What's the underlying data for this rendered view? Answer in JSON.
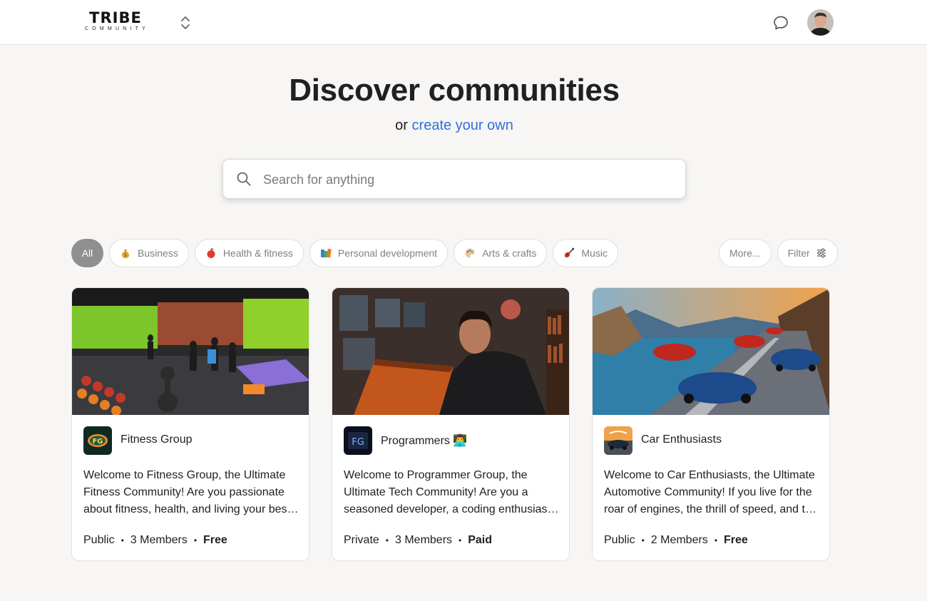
{
  "header": {
    "logo_main": "TRIBE",
    "logo_sub": "COMMUNITY"
  },
  "hero": {
    "title": "Discover communities",
    "subtitle_prefix": "or",
    "subtitle_link": "create your own"
  },
  "search": {
    "placeholder": "Search for anything",
    "value": ""
  },
  "categories": [
    {
      "label": "All",
      "active": true
    },
    {
      "label": "Business",
      "icon": "money-bag-icon"
    },
    {
      "label": "Health & fitness",
      "icon": "apple-icon"
    },
    {
      "label": "Personal development",
      "icon": "books-icon"
    },
    {
      "label": "Arts & crafts",
      "icon": "palette-icon"
    },
    {
      "label": "Music",
      "icon": "guitar-icon"
    }
  ],
  "more_label": "More...",
  "filter_label": "Filter",
  "cards": [
    {
      "name": "Fitness Group",
      "description": "Welcome to Fitness Group, the Ultimate Fitness Community! Are you passionate about fitness, health, and living your best life?",
      "privacy": "Public",
      "members": "3 Members",
      "price": "Free"
    },
    {
      "name": "Programmers 👨‍💻",
      "description": "Welcome to Programmer Group, the Ultimate Tech Community! Are you a seasoned developer, a coding enthusiast, or just starting out?",
      "privacy": "Private",
      "members": "3 Members",
      "price": "Paid"
    },
    {
      "name": "Car Enthusiasts",
      "description": "Welcome to Car Enthusiasts, the Ultimate Automotive Community! If you live for the roar of engines, the thrill of speed, and the beauty of cars...",
      "privacy": "Public",
      "members": "2 Members",
      "price": "Free"
    }
  ],
  "colors": {
    "accent_link": "#2f6fe0",
    "background": "#f7f6f4",
    "chip_active": "#8f8f8f"
  }
}
